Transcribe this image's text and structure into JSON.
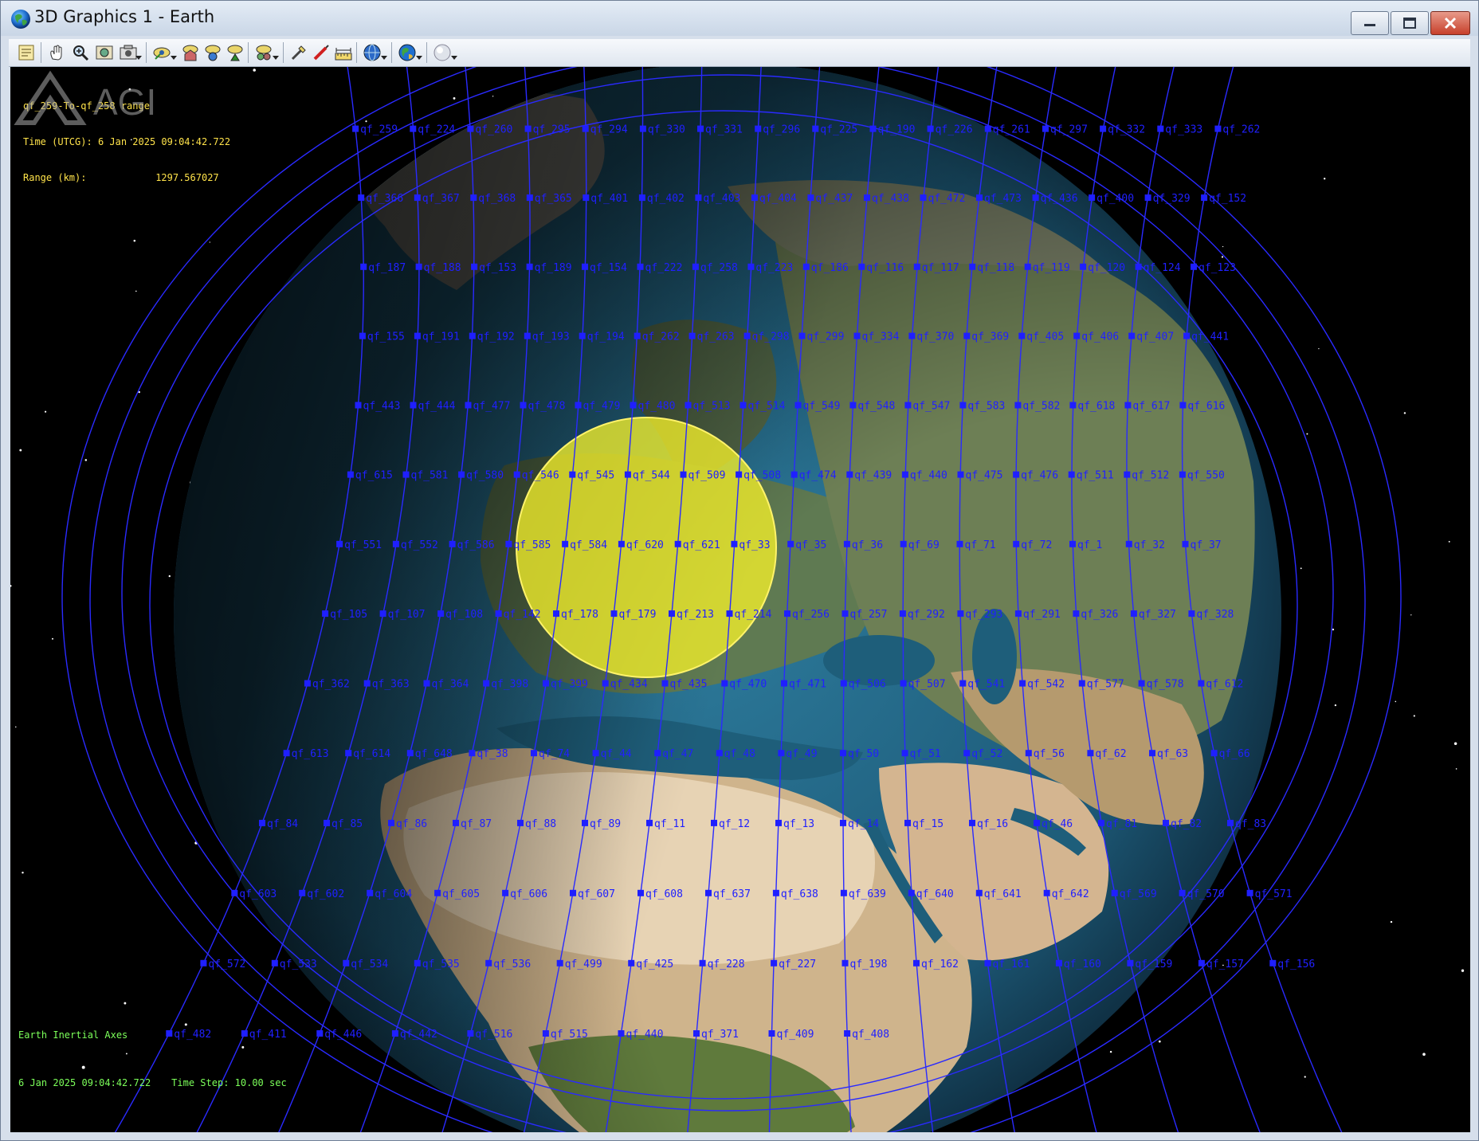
{
  "window": {
    "title": "3D Graphics 1 - Earth",
    "icon": "earth-globe-icon",
    "controls": [
      "minimize-icon",
      "maximize-icon",
      "close-icon"
    ]
  },
  "toolbar": {
    "icons": [
      "properties-icon",
      "pan-hand-icon",
      "zoom-icon",
      "save-image-icon",
      "snapshot-icon",
      "view-from-icon",
      "home-view-icon",
      "orbit-view-icon",
      "north-view-icon",
      "view-options-icon",
      "pick-tool-icon",
      "measure-pen-icon",
      "ruler-icon",
      "globe-settings-icon",
      "earth-layers-icon",
      "lighting-icon"
    ]
  },
  "hud": {
    "title": "qf_259-To-qf_258 range",
    "time_label": "Time (UTCG):",
    "time_value": "6 Jan 2025 09:04:42.722",
    "range_label": "Range (km):",
    "range_value": "1297.567027",
    "axes": "Earth Inertial Axes",
    "bottom_time": "6 Jan 2025 09:04:42.722",
    "time_step": "Time Step: 10.00 sec"
  },
  "colors": {
    "satellite": "#1f1fff",
    "orbit": "#2a2aff",
    "coverage": "#f3f02a",
    "hud_yellow": "#ffe34a",
    "hud_green": "#7cff5a"
  },
  "satellites": [
    "qf_259",
    "qf_224",
    "qf_260",
    "qf_295",
    "qf_294",
    "qf_330",
    "qf_331",
    "qf_296",
    "qf_225",
    "qf_190",
    "qf_226",
    "qf_261",
    "qf_297",
    "qf_332",
    "qf_333",
    "qf_262",
    "qf_366",
    "qf_367",
    "qf_368",
    "qf_365",
    "qf_401",
    "qf_402",
    "qf_403",
    "qf_404",
    "qf_437",
    "qf_438",
    "qf_472",
    "qf_473",
    "qf_436",
    "qf_400",
    "qf_329",
    "qf_152",
    "qf_187",
    "qf_188",
    "qf_153",
    "qf_189",
    "qf_154",
    "qf_222",
    "qf_258",
    "qf_223",
    "qf_186",
    "qf_116",
    "qf_117",
    "qf_118",
    "qf_119",
    "qf_120",
    "qf_124",
    "qf_123",
    "qf_155",
    "qf_191",
    "qf_192",
    "qf_193",
    "qf_194",
    "qf_262",
    "qf_263",
    "qf_298",
    "qf_299",
    "qf_334",
    "qf_370",
    "qf_369",
    "qf_405",
    "qf_406",
    "qf_407",
    "qf_441",
    "qf_443",
    "qf_444",
    "qf_477",
    "qf_478",
    "qf_479",
    "qf_480",
    "qf_513",
    "qf_514",
    "qf_549",
    "qf_548",
    "qf_547",
    "qf_583",
    "qf_582",
    "qf_618",
    "qf_617",
    "qf_616",
    "qf_615",
    "qf_581",
    "qf_580",
    "qf_546",
    "qf_545",
    "qf_544",
    "qf_509",
    "qf_508",
    "qf_474",
    "qf_439",
    "qf_440",
    "qf_475",
    "qf_476",
    "qf_511",
    "qf_512",
    "qf_550",
    "qf_551",
    "qf_552",
    "qf_586",
    "qf_585",
    "qf_584",
    "qf_620",
    "qf_621",
    "qf_33",
    "qf_35",
    "qf_36",
    "qf_69",
    "qf_71",
    "qf_72",
    "qf_1",
    "qf_32",
    "qf_37",
    "qf_105",
    "qf_107",
    "qf_108",
    "qf_142",
    "qf_178",
    "qf_179",
    "qf_213",
    "qf_214",
    "qf_256",
    "qf_257",
    "qf_292",
    "qf_293",
    "qf_291",
    "qf_326",
    "qf_327",
    "qf_328",
    "qf_362",
    "qf_363",
    "qf_364",
    "qf_398",
    "qf_399",
    "qf_434",
    "qf_435",
    "qf_470",
    "qf_471",
    "qf_506",
    "qf_507",
    "qf_541",
    "qf_542",
    "qf_577",
    "qf_578",
    "qf_612",
    "qf_613",
    "qf_614",
    "qf_648",
    "qf_38",
    "qf_74",
    "qf_44",
    "qf_47",
    "qf_48",
    "qf_49",
    "qf_50",
    "qf_51",
    "qf_52",
    "qf_56",
    "qf_62",
    "qf_63",
    "qf_66",
    "qf_84",
    "qf_85",
    "qf_86",
    "qf_87",
    "qf_88",
    "qf_89",
    "qf_11",
    "qf_12",
    "qf_13",
    "qf_14",
    "qf_15",
    "qf_16",
    "qf_46",
    "qf_81",
    "qf_82",
    "qf_83",
    "qf_603",
    "qf_602",
    "qf_604",
    "qf_605",
    "qf_606",
    "qf_607",
    "qf_608",
    "qf_637",
    "qf_638",
    "qf_639",
    "qf_640",
    "qf_641",
    "qf_642",
    "qf_569",
    "qf_570",
    "qf_571",
    "qf_572",
    "qf_533",
    "qf_534",
    "qf_535",
    "qf_536",
    "qf_499",
    "qf_425",
    "qf_228",
    "qf_227",
    "qf_198",
    "qf_162",
    "qf_161",
    "qf_160",
    "qf_159",
    "qf_157",
    "qf_156",
    "qf_482",
    "qf_411",
    "qf_446",
    "qf_442",
    "qf_516",
    "qf_515",
    "qf_440",
    "qf_371",
    "qf_409",
    "qf_408"
  ],
  "branding": {
    "logo_text": "AGI"
  }
}
